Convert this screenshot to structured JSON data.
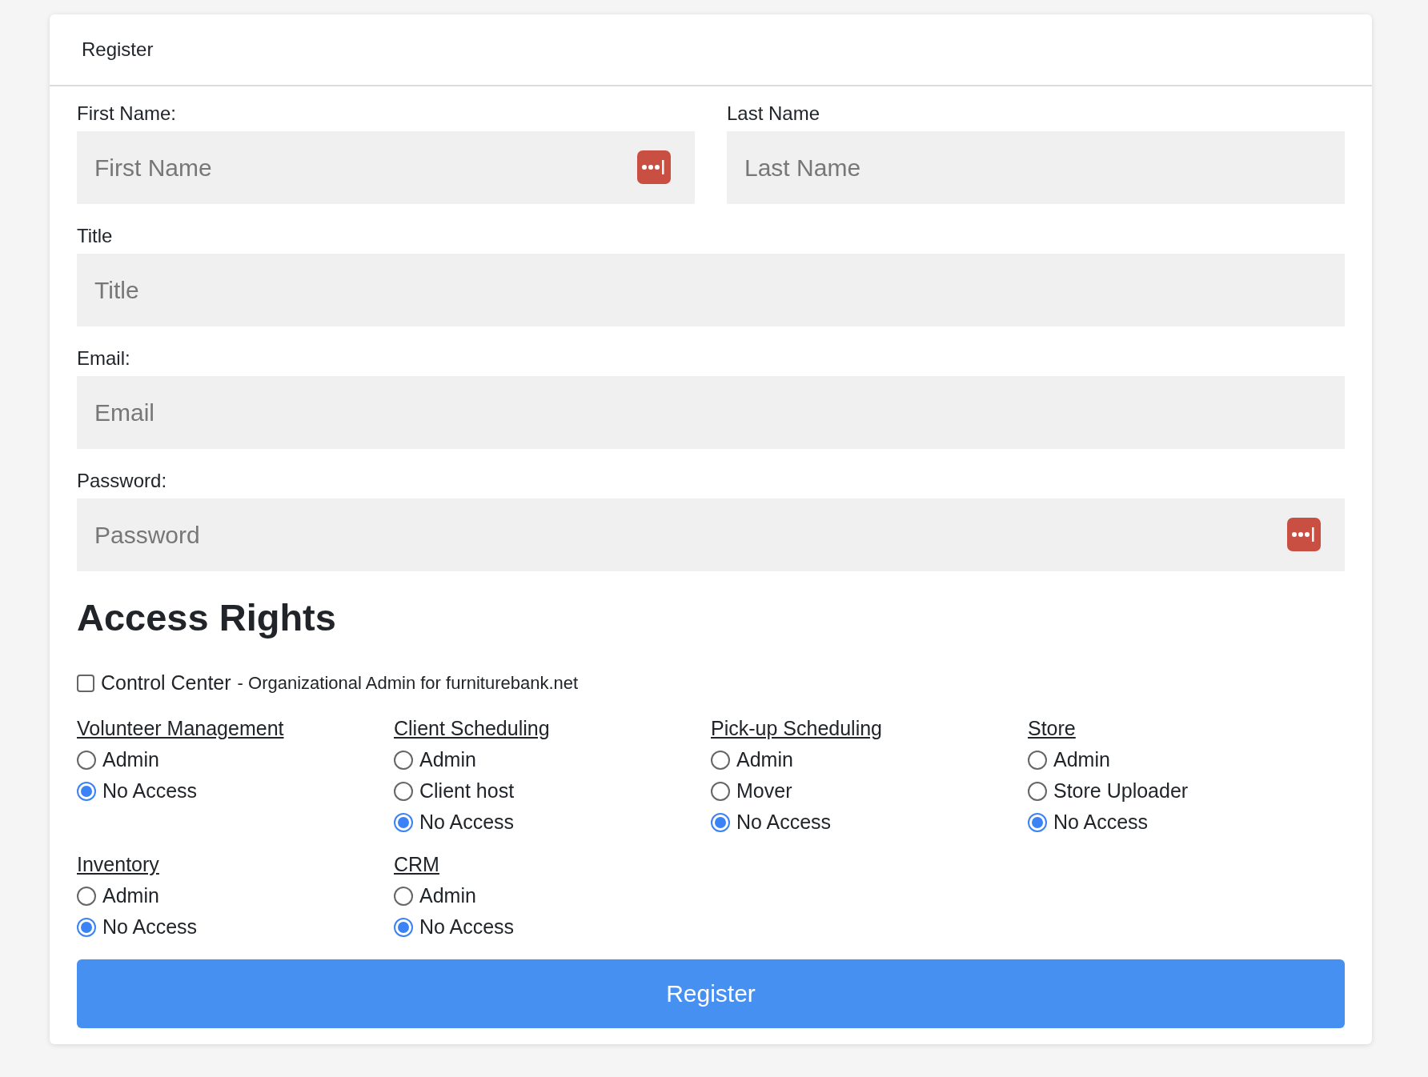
{
  "card": {
    "title": "Register"
  },
  "field_rows": [
    [
      {
        "label": "First Name:",
        "placeholder": "First Name",
        "autofill_icon": true
      },
      {
        "label": "Last Name",
        "placeholder": "Last Name",
        "autofill_icon": false
      }
    ],
    [
      {
        "label": "Title",
        "placeholder": "Title",
        "autofill_icon": false
      }
    ],
    [
      {
        "label": "Email:",
        "placeholder": "Email",
        "autofill_icon": false
      }
    ],
    [
      {
        "label": "Password:",
        "placeholder": "Password",
        "autofill_icon": true
      }
    ]
  ],
  "access_rights": {
    "heading": "Access Rights",
    "control_center": {
      "label": "Control Center",
      "description": "- Organizational Admin for furniturebank.net",
      "checked": false
    },
    "groups": [
      {
        "title": "Volunteer Management",
        "options": [
          {
            "label": "Admin",
            "selected": false
          },
          {
            "label": "No Access",
            "selected": true
          }
        ]
      },
      {
        "title": "Client Scheduling",
        "options": [
          {
            "label": "Admin",
            "selected": false
          },
          {
            "label": "Client host",
            "selected": false
          },
          {
            "label": "No Access",
            "selected": true
          }
        ]
      },
      {
        "title": "Pick-up Scheduling",
        "options": [
          {
            "label": "Admin",
            "selected": false
          },
          {
            "label": "Mover",
            "selected": false
          },
          {
            "label": "No Access",
            "selected": true
          }
        ]
      },
      {
        "title": "Store",
        "options": [
          {
            "label": "Admin",
            "selected": false
          },
          {
            "label": "Store Uploader",
            "selected": false
          },
          {
            "label": "No Access",
            "selected": true
          }
        ]
      },
      {
        "title": "Inventory",
        "options": [
          {
            "label": "Admin",
            "selected": false
          },
          {
            "label": "No Access",
            "selected": true
          }
        ]
      },
      {
        "title": "CRM",
        "options": [
          {
            "label": "Admin",
            "selected": false
          },
          {
            "label": "No Access",
            "selected": true
          }
        ]
      }
    ]
  },
  "submit": {
    "label": "Register"
  }
}
